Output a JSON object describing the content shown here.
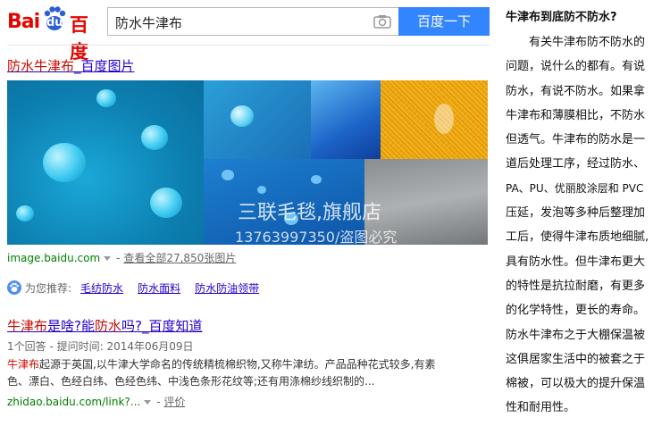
{
  "logo": {
    "bai": "Bai",
    "du": "du",
    "cn": "百度"
  },
  "search": {
    "query": "防水牛津布",
    "button": "百度一下",
    "camera_icon": "camera-icon"
  },
  "result_images": {
    "title_hl": "防水牛津布",
    "title_rest": "_百度图片",
    "watermark_line1": "三联毛毯,旗舰店",
    "watermark_line2": "13763997350/盗图必究",
    "url": "image.baidu.com",
    "more_link": "查看全部27,850张图片"
  },
  "recommend": {
    "label": "为您推荐:",
    "links": [
      "毛纺防水",
      "防水面料",
      "防水防油领带"
    ]
  },
  "result_zhidao": {
    "title_p1": "牛津布",
    "title_p2": "是啥?能",
    "title_p3": "防水",
    "title_p4": "吗?_百度知道",
    "meta": "1个回答 - 提问时间: 2014年06月09日",
    "snippet_hl": "牛津布",
    "snippet_line1_rest": "起源于英国,以牛津大学命名的传统精梳棉织物,又称牛津纺。产品品种花式较多,有素",
    "snippet_line2": "色、漂白、色经白纬、色经色纬、中浅色条形花纹等;还有用涤棉纱线织制的...",
    "url": "zhidao.baidu.com/link?...",
    "review": "评价"
  },
  "article": {
    "title": "牛津布到底防不防水?",
    "lines": [
      "　　有关牛津布防不防水的",
      "问题，说什么的都有。有说",
      "防水，有说不防水。如果拿",
      "牛津布和薄膜相比，不防水",
      "但透气。牛津布的防水是一",
      "道后处理工序，经过防水、",
      "PA、PU、优丽胶涂层和 PVC",
      "压延，发泡等多种后整理加",
      "工后，使得牛津布质地细腻,",
      "具有防水性。但牛津布更大",
      "的特性是抗拉耐磨，有更多",
      "的化学特性，更长的寿命。",
      "防水牛津布之于大棚保温被",
      "这俱居家生活中的被套之于",
      "棉被，可以极大的提升保温",
      "性和耐用性。"
    ]
  },
  "colors": {
    "brand_red": "#e10602",
    "link": "#2200cc",
    "highlight": "#c60a00",
    "url_green": "#008000",
    "button_blue": "#3385ff"
  }
}
